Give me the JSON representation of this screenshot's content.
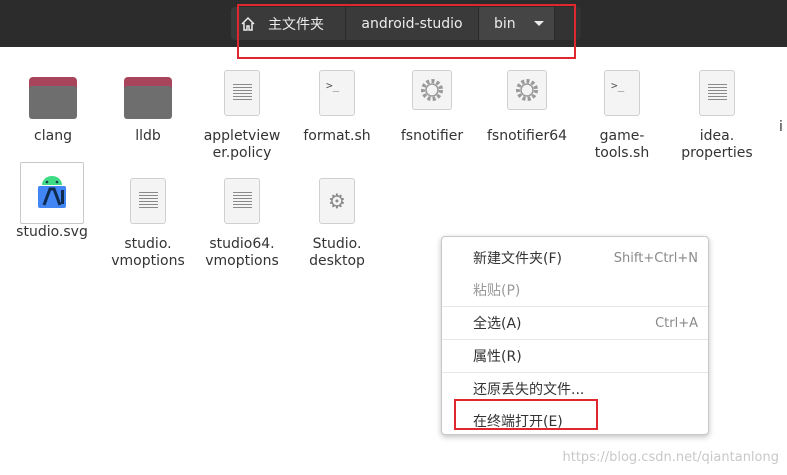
{
  "breadcrumb": {
    "home": "主文件夹",
    "folder1": "android-studio",
    "folder2": "bin"
  },
  "files": [
    {
      "label": "clang",
      "type": "folder"
    },
    {
      "label": "lldb",
      "type": "folder"
    },
    {
      "label": "appletview\ner.policy",
      "type": "text"
    },
    {
      "label": "format.sh",
      "type": "script"
    },
    {
      "label": "fsnotifier",
      "type": "binary"
    },
    {
      "label": "fsnotifier64",
      "type": "binary"
    },
    {
      "label": "game-\ntools.sh",
      "type": "script"
    },
    {
      "label": "idea.\nproperties",
      "type": "text"
    },
    {
      "label": "studio.svg",
      "type": "image"
    },
    {
      "label": "studio.\nvmoptions",
      "type": "text"
    },
    {
      "label": "studio64.\nvmoptions",
      "type": "text"
    },
    {
      "label": "Studio.\ndesktop",
      "type": "desktop"
    }
  ],
  "cut_label": "i",
  "menu": {
    "new_folder": "新建文件夹(F)",
    "new_folder_acc": "Shift+Ctrl+N",
    "paste": "粘贴(P)",
    "select_all": "全选(A)",
    "select_all_acc": "Ctrl+A",
    "properties": "属性(R)",
    "restore": "还原丢失的文件...",
    "open_terminal": "在终端打开(E)"
  },
  "watermark": "https://blog.csdn.net/qiantanlong",
  "colors": {
    "header_bg": "#2c2c2c",
    "folder_accent": "#a8445c",
    "highlight_red": "#e0262e"
  }
}
